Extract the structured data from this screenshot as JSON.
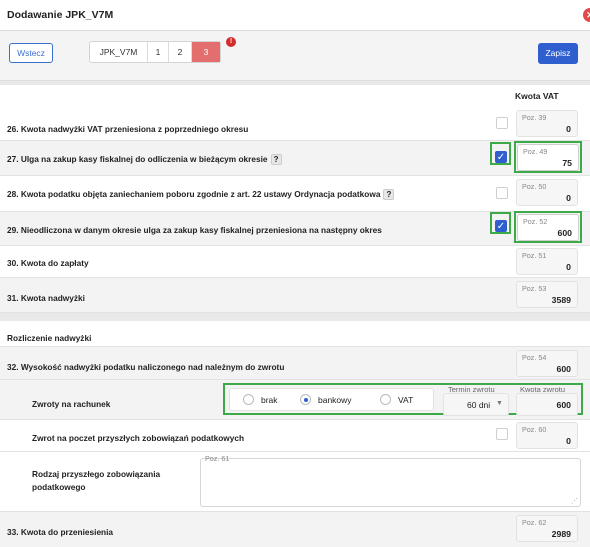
{
  "window": {
    "title": "Dodawanie JPK_V7M",
    "close_glyph": "✕"
  },
  "toolbar": {
    "back_label": "Wstecz",
    "steps": [
      "JPK_V7M",
      "1",
      "2",
      "3"
    ],
    "badge": "!",
    "save_label": "Zapisz"
  },
  "column_header": "Kwota VAT",
  "rows": [
    {
      "label": "26. Kwota nadwyżki VAT przeniesiona z poprzedniego okresu",
      "poz": "Poz. 39",
      "value": "0",
      "checked": false
    },
    {
      "label": "27. Ulga na zakup kasy fiskalnej do odliczenia w bieżącym okresie",
      "poz": "Poz. 49",
      "value": "75",
      "checked": true,
      "help": "?"
    },
    {
      "label": "28. Kwota podatku objęta zaniechaniem poboru zgodnie z art. 22 ustawy Ordynacja podatkowa",
      "poz": "Poz. 50",
      "value": "0",
      "checked": false,
      "help": "?"
    },
    {
      "label": "29. Nieodliczona w danym okresie ulga za zakup kasy fiskalnej przeniesiona na następny okres",
      "poz": "Poz. 52",
      "value": "600",
      "checked": true
    },
    {
      "label": "30. Kwota do zapłaty",
      "poz": "Poz. 51",
      "value": "0"
    },
    {
      "label": "31. Kwota nadwyżki",
      "poz": "Poz. 53",
      "value": "3589"
    }
  ],
  "refund": {
    "section_title": "Rozliczenie nadwyżki",
    "row32": {
      "label": "32. Wysokość nadwyżki podatku naliczonego nad należnym do zwrotu",
      "poz": "Poz. 54",
      "value": "600"
    },
    "zwroty": {
      "label": "Zwroty na rachunek",
      "options": [
        "brak",
        "bankowy",
        "VAT"
      ],
      "selected": "bankowy",
      "termin_label": "Termin zwrotu",
      "termin_value": "60 dni",
      "kwota_label": "Kwota zwrotu",
      "kwota_value": "600"
    },
    "future": {
      "label": "Zwrot na poczet przyszłych zobowiązań podatkowych",
      "poz": "Poz. 60",
      "value": "0"
    },
    "rodzaj": {
      "label_line1": "Rodzaj przyszłego zobowiązania",
      "label_line2": "podatkowego",
      "poz": "Poz. 61",
      "value": ""
    },
    "row33": {
      "label": "33. Kwota do przeniesienia",
      "poz": "Poz. 62",
      "value": "2989"
    }
  }
}
